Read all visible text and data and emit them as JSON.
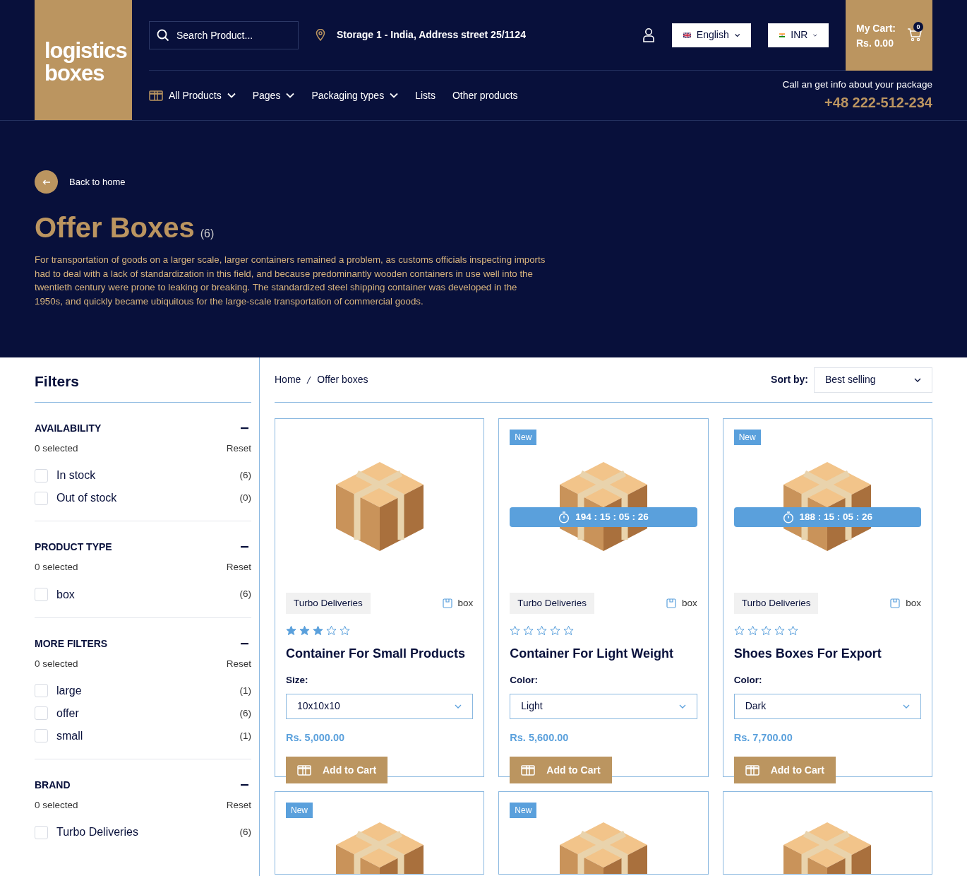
{
  "logo": {
    "line1": "logistics",
    "line2": "boxes"
  },
  "search": {
    "placeholder": "Search Product..."
  },
  "location": "Storage 1 - India, Address street 25/1124",
  "language": "English",
  "currency": "INR",
  "cart": {
    "label": "My Cart:",
    "total": "Rs. 0.00",
    "count": "0"
  },
  "nav": [
    {
      "label": "All Products",
      "dropdown": true,
      "icon": true
    },
    {
      "label": "Pages",
      "dropdown": true,
      "icon": false
    },
    {
      "label": "Packaging types",
      "dropdown": true,
      "icon": false
    },
    {
      "label": "Lists",
      "dropdown": false,
      "icon": false
    },
    {
      "label": "Other products",
      "dropdown": false,
      "icon": false
    }
  ],
  "contact": {
    "text": "Call an get info about your package",
    "phone": "+48 222-512-234"
  },
  "hero": {
    "back": "Back to home",
    "title": "Offer Boxes",
    "count": "(6)",
    "description": "For transportation of goods on a larger scale, larger containers remained a problem, as customs officials inspecting imports had to deal with a lack of standardization in this field, and because predominantly wooden containers in use well into the twentieth century were prone to leaking or breaking. The standardized steel shipping container was developed in the 1950s, and quickly became ubiquitous for the large-scale transportation of commercial goods."
  },
  "filters": {
    "title": "Filters",
    "sections": [
      {
        "title": "AVAILABILITY",
        "selected": "0 selected",
        "reset": "Reset",
        "options": [
          {
            "label": "In stock",
            "count": "(6)",
            "checked": false
          },
          {
            "label": "Out of stock",
            "count": "(0)",
            "checked": false
          }
        ]
      },
      {
        "title": "PRODUCT TYPE",
        "selected": "0 selected",
        "reset": "Reset",
        "options": [
          {
            "label": "box",
            "count": "(6)",
            "checked": false
          }
        ]
      },
      {
        "title": "MORE FILTERS",
        "selected": "0 selected",
        "reset": "Reset",
        "options": [
          {
            "label": "large",
            "count": "(1)",
            "checked": false
          },
          {
            "label": "offer",
            "count": "(6)",
            "checked": false
          },
          {
            "label": "small",
            "count": "(1)",
            "checked": false
          }
        ]
      },
      {
        "title": "BRAND",
        "selected": "0 selected",
        "reset": "Reset",
        "options": [
          {
            "label": "Turbo Deliveries",
            "count": "(6)",
            "checked": false
          }
        ]
      }
    ]
  },
  "breadcrumb": [
    "Home",
    "Offer boxes"
  ],
  "sort": {
    "label": "Sort by:",
    "value": "Best selling"
  },
  "products": [
    {
      "kind": "full",
      "vendor": "Turbo Deliveries",
      "type": "box",
      "stars": 3,
      "name": "Container For Small Products",
      "option_label": "Size:",
      "option_value": "10x10x10",
      "price": "Rs. 5,000.00",
      "button": "Add to Cart"
    },
    {
      "kind": "full",
      "badge": "New",
      "timer": "194 : 15 : 05 : 26",
      "vendor": "Turbo Deliveries",
      "type": "box",
      "stars": 0,
      "name": "Container For Light Weight",
      "option_label": "Color:",
      "option_value": "Light",
      "price": "Rs. 5,600.00",
      "button": "Add to Cart"
    },
    {
      "kind": "full",
      "badge": "New",
      "timer": "188 : 15 : 05 : 26",
      "vendor": "Turbo Deliveries",
      "type": "box",
      "stars": 0,
      "name": "Shoes Boxes For Export",
      "option_label": "Color:",
      "option_value": "Dark",
      "price": "Rs. 7,700.00",
      "button": "Add to Cart"
    },
    {
      "kind": "partial",
      "badge": "New"
    },
    {
      "kind": "partial",
      "badge": "New"
    },
    {
      "kind": "partial"
    }
  ]
}
